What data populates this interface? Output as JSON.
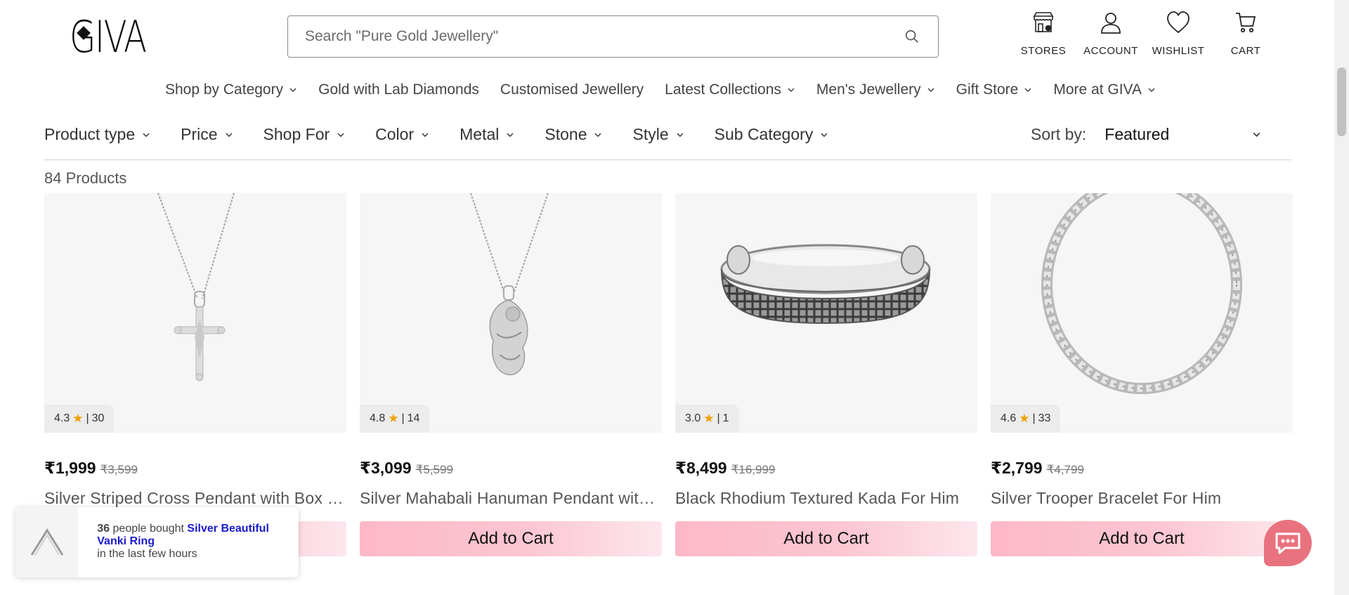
{
  "brand": {
    "name": "GIVA"
  },
  "search": {
    "placeholder": "Search \"Pure Gold Jewellery\""
  },
  "header_icons": [
    {
      "label": "STORES",
      "icon": "store-icon"
    },
    {
      "label": "ACCOUNT",
      "icon": "account-icon"
    },
    {
      "label": "WISHLIST",
      "icon": "heart-icon"
    },
    {
      "label": "CART",
      "icon": "cart-icon"
    }
  ],
  "nav": [
    {
      "label": "Shop by Category",
      "dropdown": true
    },
    {
      "label": "Gold with Lab Diamonds",
      "dropdown": false
    },
    {
      "label": "Customised Jewellery",
      "dropdown": false
    },
    {
      "label": "Latest Collections",
      "dropdown": true
    },
    {
      "label": "Men's Jewellery",
      "dropdown": true
    },
    {
      "label": "Gift Store",
      "dropdown": true
    },
    {
      "label": "More at GIVA",
      "dropdown": true
    }
  ],
  "filters": [
    "Product type",
    "Price",
    "Shop For",
    "Color",
    "Metal",
    "Stone",
    "Style",
    "Sub Category"
  ],
  "sort": {
    "label": "Sort by:",
    "value": "Featured"
  },
  "product_count": "84 Products",
  "products": [
    {
      "rating": "4.3",
      "reviews": "30",
      "price": "₹1,999",
      "mrp": "₹3,599",
      "title": "Silver Striped Cross Pendant with Box Chain For Him",
      "cta": "Add to Cart"
    },
    {
      "rating": "4.8",
      "reviews": "14",
      "price": "₹3,099",
      "mrp": "₹5,599",
      "title": "Silver Mahabali Hanuman Pendant with Box Chain",
      "cta": "Add to Cart"
    },
    {
      "rating": "3.0",
      "reviews": "1",
      "price": "₹8,499",
      "mrp": "₹16,999",
      "title": "Black Rhodium Textured Kada For Him",
      "cta": "Add to Cart"
    },
    {
      "rating": "4.6",
      "reviews": "33",
      "price": "₹2,799",
      "mrp": "₹4,799",
      "title": "Silver Trooper Bracelet For Him",
      "cta": "Add to Cart"
    }
  ],
  "toast": {
    "count": "36",
    "text1": "people bought",
    "product": "Silver Beautiful Vanki Ring",
    "text2": "in the last few hours"
  },
  "colors": {
    "cta_pink": "#fdb8c7",
    "chat": "#e8727e",
    "star": "#f0a000",
    "toast_link": "#1a1ad0"
  }
}
